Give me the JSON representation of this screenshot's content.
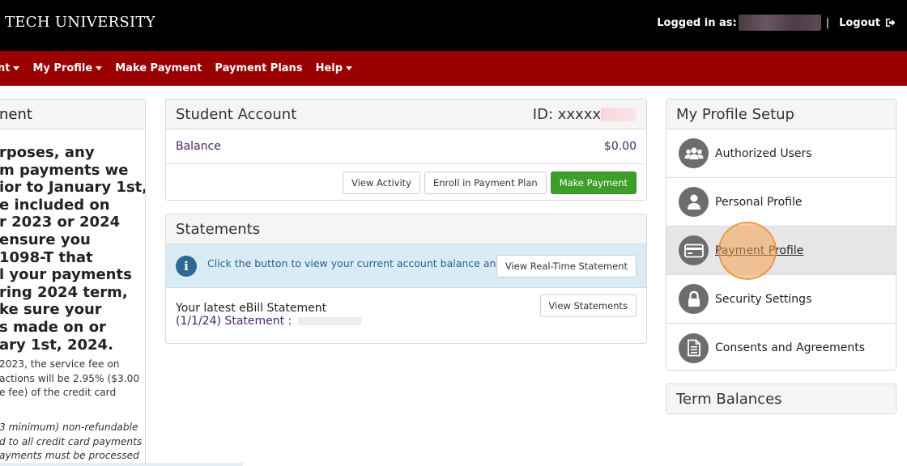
{
  "header": {
    "brand": "TECH UNIVERSITY",
    "logged_in_label": "Logged in as:",
    "separator": "|",
    "logout_label": "Logout"
  },
  "nav": {
    "items": [
      {
        "label": "nt",
        "has_caret": true
      },
      {
        "label": "My Profile",
        "has_caret": true
      },
      {
        "label": "Make Payment",
        "has_caret": false
      },
      {
        "label": "Payment Plans",
        "has_caret": false
      },
      {
        "label": "Help",
        "has_caret": true
      }
    ]
  },
  "left_panel": {
    "heading": "nent",
    "bold_lines": [
      "rposes, any",
      "m payments we",
      "ior to January 1st,",
      "e included on",
      "r 2023 or 2024",
      " ensure you",
      "1098-T that",
      "l your payments",
      "ring 2024 term,",
      "ke sure your",
      "s made on or",
      "ary 1st, 2024."
    ],
    "normal_lines": [
      " 2023, the service fee on",
      "actions will be 2.95% ($3.00",
      "e fee) of the credit card"
    ],
    "italic_lines": [
      "3 minimum) non-refundable",
      "d to all credit card payments",
      "ayments must be processed"
    ]
  },
  "student_account": {
    "title": "Student Account",
    "id_label": "ID: xxxxx",
    "balance_label": "Balance",
    "balance_value": "$0.00",
    "buttons": {
      "view_activity": "View Activity",
      "enroll": "Enroll in Payment Plan",
      "make_payment": "Make Payment"
    }
  },
  "statements": {
    "title": "Statements",
    "info_text": "Click the button to view your current account balance and details.",
    "realtime_button": "View Real-Time Statement",
    "latest_title": "Your latest eBill Statement",
    "latest_statement": "(1/1/24) Statement :",
    "view_statements_button": "View Statements"
  },
  "profile_setup": {
    "title": "My Profile Setup",
    "items": [
      {
        "label": "Authorized Users",
        "icon": "users-icon"
      },
      {
        "label": "Personal Profile",
        "icon": "user-icon"
      },
      {
        "label": "Payment Profile",
        "icon": "credit-card-icon"
      },
      {
        "label": "Security Settings",
        "icon": "lock-icon"
      },
      {
        "label": "Consents and Agreements",
        "icon": "document-icon"
      }
    ]
  },
  "term_balances": {
    "title": "Term Balances"
  },
  "colors": {
    "header_bg": "#000000",
    "nav_bg": "#9a0000",
    "link_purple": "#4b1f6f",
    "green_button": "#3d9f29",
    "info_bg": "#d9ecf6"
  }
}
